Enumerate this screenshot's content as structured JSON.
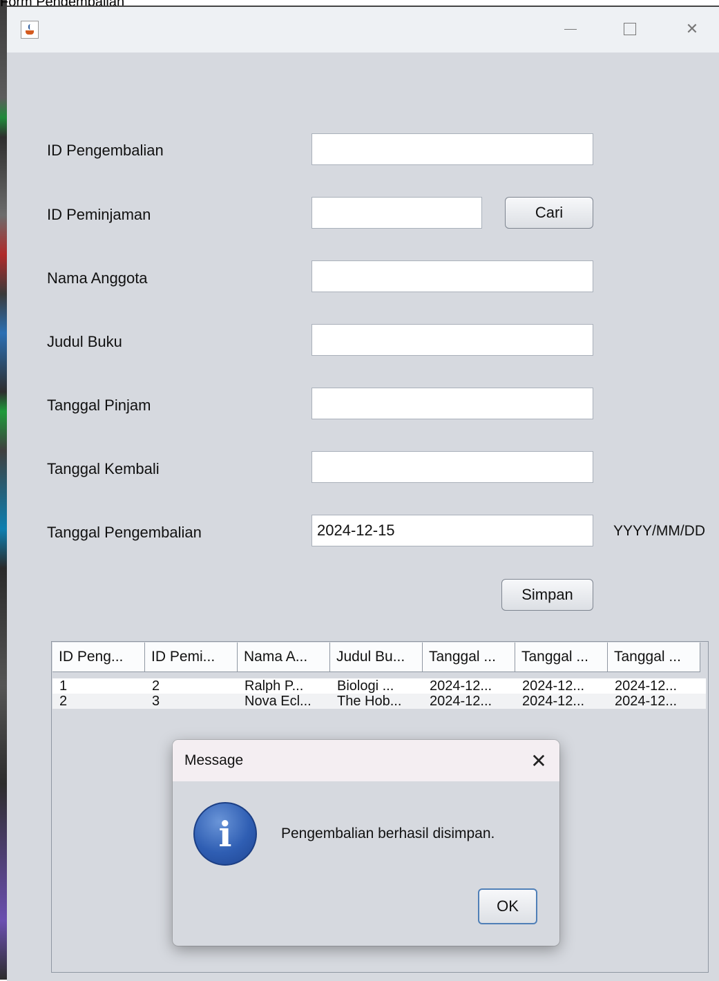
{
  "window": {
    "caption": "Form Pengembalian"
  },
  "form": {
    "labels": {
      "id_pengembalian": "ID Pengembalian",
      "id_peminjaman": "ID Peminjaman",
      "nama_anggota": "Nama Anggota",
      "judul_buku": "Judul Buku",
      "tanggal_pinjam": "Tanggal Pinjam",
      "tanggal_kembali": "Tanggal Kembali",
      "tanggal_pengembalian": "Tanggal Pengembalian"
    },
    "values": {
      "id_pengembalian": "",
      "id_peminjaman": "",
      "nama_anggota": "",
      "judul_buku": "",
      "tanggal_pinjam": "",
      "tanggal_kembali": "",
      "tanggal_pengembalian": "2024-12-15"
    },
    "date_hint": "YYYY/MM/DD",
    "cari_label": "Cari",
    "simpan_label": "Simpan"
  },
  "table": {
    "headers": [
      "ID Peng...",
      "ID Pemi...",
      "Nama A...",
      "Judul Bu...",
      "Tanggal ...",
      "Tanggal ...",
      "Tanggal ..."
    ],
    "rows": [
      [
        "1",
        "2",
        "Ralph P...",
        "Biologi ...",
        "2024-12...",
        "2024-12...",
        "2024-12..."
      ],
      [
        "2",
        "3",
        "Nova Ecl...",
        "The Hob...",
        "2024-12...",
        "2024-12...",
        "2024-12..."
      ]
    ]
  },
  "dialog": {
    "title": "Message",
    "icon": "info-icon",
    "message": "Pengembalian berhasil disimpan.",
    "ok_label": "OK"
  }
}
